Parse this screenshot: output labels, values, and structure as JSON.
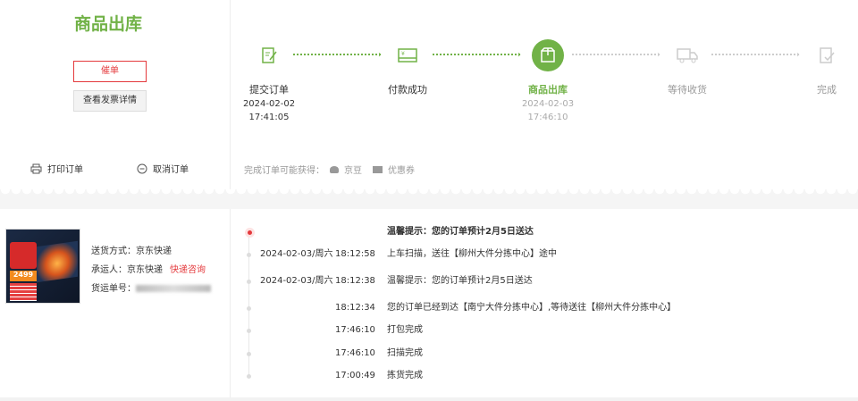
{
  "order": {
    "status_title": "商品出库",
    "urge_button": "催单",
    "invoice_button": "查看发票详情",
    "print_label": "打印订单",
    "cancel_label": "取消订单"
  },
  "accent": "#71b247",
  "danger": "#e4393c",
  "steps": [
    {
      "label": "提交订单",
      "date": "2024-02-02",
      "time": "17:41:05",
      "icon": "edit-document-icon",
      "state": "done"
    },
    {
      "label": "付款成功",
      "date": "",
      "time": "",
      "icon": "payment-card-icon",
      "state": "done"
    },
    {
      "label": "商品出库",
      "date": "2024-02-03",
      "time": "17:46:10",
      "icon": "package-icon",
      "state": "current"
    },
    {
      "label": "等待收货",
      "date": "",
      "time": "",
      "icon": "truck-icon",
      "state": "pending"
    },
    {
      "label": "完成",
      "date": "",
      "time": "",
      "icon": "check-document-icon",
      "state": "pending"
    }
  ],
  "rewards": {
    "label": "完成订单可能获得：",
    "bean": "京豆",
    "coupon": "优惠券"
  },
  "shipment": {
    "method_label": "送货方式：",
    "method": "京东快递",
    "carrier_label": "承运人：",
    "carrier": "京东快递",
    "inquiry_link": "快递咨询",
    "tracking_label": "货运单号：",
    "product_price": "2499"
  },
  "tracking": [
    {
      "date": "",
      "time": "",
      "msg": "温馨提示：您的订单预计2月5日送达"
    },
    {
      "date": "2024-02-03/周六",
      "time": "18:12:58",
      "msg": "上车扫描，送往【柳州大件分拣中心】途中"
    },
    {
      "date": "2024-02-03/周六",
      "time": "18:12:38",
      "msg": "温馨提示：您的订单预计2月5日送达"
    },
    {
      "date": "",
      "time": "18:12:34",
      "msg": "您的订单已经到达【南宁大件分拣中心】,等待送往【柳州大件分拣中心】"
    },
    {
      "date": "",
      "time": "17:46:10",
      "msg": "打包完成"
    },
    {
      "date": "",
      "time": "17:46:10",
      "msg": "扫描完成"
    },
    {
      "date": "",
      "time": "17:00:49",
      "msg": "拣货完成"
    }
  ]
}
